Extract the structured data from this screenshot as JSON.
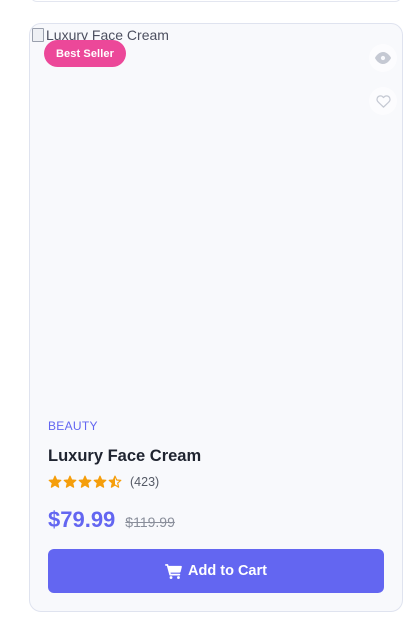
{
  "product": {
    "image_alt": "Luxury Face Cream",
    "badge": "Best Seller",
    "category": "BEAUTY",
    "name": "Luxury Face Cream",
    "rating": 4.5,
    "rating_max": 5,
    "reviews": "(423)",
    "price": "$79.99",
    "old_price": "$119.99",
    "add_to_cart_label": "Add to Cart"
  },
  "icons": {
    "quick_view": "eye-icon",
    "wishlist": "heart-icon",
    "cart": "cart-icon",
    "star": "star-icon"
  },
  "colors": {
    "accent": "#6366f1",
    "badge": "#ec4899",
    "star": "#f59e0b",
    "card_bg": "#f8f9fc"
  }
}
